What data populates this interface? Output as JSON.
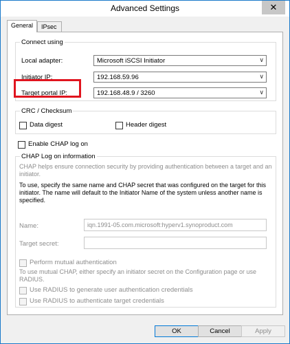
{
  "window": {
    "title": "Advanced Settings",
    "close_glyph": "✕"
  },
  "tabs": [
    {
      "label": "General",
      "active": true
    },
    {
      "label": "IPsec",
      "active": false
    }
  ],
  "connect": {
    "title": "Connect using",
    "local_adapter": {
      "label": "Local adapter:",
      "value": "Microsoft iSCSI Initiator"
    },
    "initiator_ip": {
      "label": "Initiator IP:",
      "value": "192.168.59.96"
    },
    "target_portal_ip": {
      "label": "Target portal IP:",
      "value": "192.168.48.9 / 3260"
    }
  },
  "crc": {
    "title": "CRC / Checksum",
    "data_digest": {
      "label": "Data digest",
      "checked": false
    },
    "header_digest": {
      "label": "Header digest",
      "checked": false
    }
  },
  "chap": {
    "enable_label": "Enable CHAP log on",
    "title": "CHAP Log on information",
    "help1": "CHAP helps ensure connection security by providing authentication between a target and an initiator.",
    "help2": "To use, specify the same name and CHAP secret that was configured on the target for this initiator.  The name will default to the Initiator Name of the system unless another name is specified.",
    "name_label": "Name:",
    "name_value": "iqn.1991-05.com.microsoft:hyperv1.synoproduct.com",
    "secret_label": "Target secret:",
    "secret_value": "",
    "mutual_label": "Perform mutual authentication",
    "mutual_help": "To use mutual CHAP, either specify an initiator secret on the Configuration page or use RADIUS.",
    "radius_user_label": "Use RADIUS to generate user authentication credentials",
    "radius_target_label": "Use RADIUS to authenticate target credentials"
  },
  "buttons": {
    "ok": "OK",
    "cancel": "Cancel",
    "apply": "Apply"
  },
  "colors": {
    "accent": "#1979ca",
    "highlight": "#e0141e",
    "primary_border": "#0078d7"
  },
  "icons": {
    "chevron": "chevron-down-icon",
    "close": "close-icon"
  }
}
